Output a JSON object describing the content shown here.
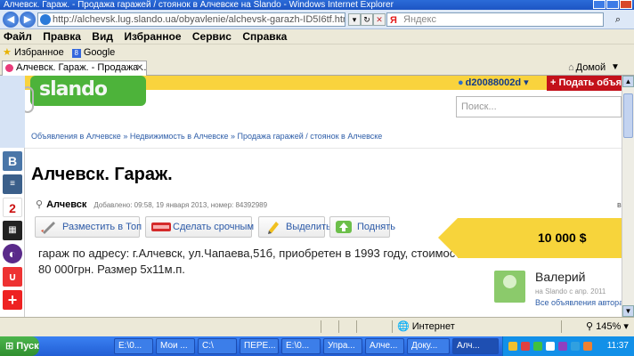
{
  "window": {
    "title": "Алчевск. Гараж. - Продажа гаражей / стоянок в Алчевске на Slando - Windows Internet Explorer"
  },
  "address_bar": {
    "url": "http://alchevsk.lug.slando.ua/obyavlenie/alchevsk-garazh-ID5I6tf.html",
    "search_placeholder": "Яндекс"
  },
  "menu": {
    "items": [
      "Файл",
      "Правка",
      "Вид",
      "Избранное",
      "Сервис",
      "Справка"
    ]
  },
  "favorites": {
    "label": "Избранное",
    "google": "Google"
  },
  "tabs": {
    "active_tab": "Алчевск. Гараж. - Продажа ...",
    "home_label": "Домой"
  },
  "page": {
    "logo_text": "slando",
    "user_name": "d20088002d",
    "post_ad_label": "+ Подать объяв",
    "search_placeholder": "Поиск...",
    "breadcrumb": "Объявления в Алчевске » Недвижимость в Алчевске » Продажа гаражей / стоянок в Алчевске",
    "title": "Алчевск. Гараж.",
    "location": "Алчевск",
    "meta": "Добавлено: 09:58, 19 января 2013, номер: 84392989",
    "actions": {
      "top": "Разместить в Топ",
      "urgent": "Сделать срочным",
      "highlight": "Выделить",
      "raise": "Поднять"
    },
    "description": "гараж по адресу: г.Алчевск, ул.Чапаева,51б, приобретен в 1993 году, стоимостью 80 000грн. Размер 5х11м.п.",
    "price": "10 000 $",
    "seller": {
      "name": "Валерий",
      "since": "на Slando с апр. 2011",
      "all_ads": "Все объявления автора"
    },
    "edge_letter": "в"
  },
  "status_bar": {
    "zone": "Интернет",
    "zoom": "145%"
  },
  "taskbar": {
    "start": "Пуск",
    "tasks": [
      "E:\\0...",
      "Мои ...",
      "C:\\",
      "ПЕРЕ...",
      "E:\\0...",
      "Упра...",
      "Алче...",
      "Доку...",
      "Алч..."
    ],
    "clock": "11:37"
  },
  "colors": {
    "slando_green": "#4db33a",
    "slando_yellow": "#f9d33d",
    "link_blue": "#2d5da8",
    "post_ad_red": "#c3111a"
  }
}
